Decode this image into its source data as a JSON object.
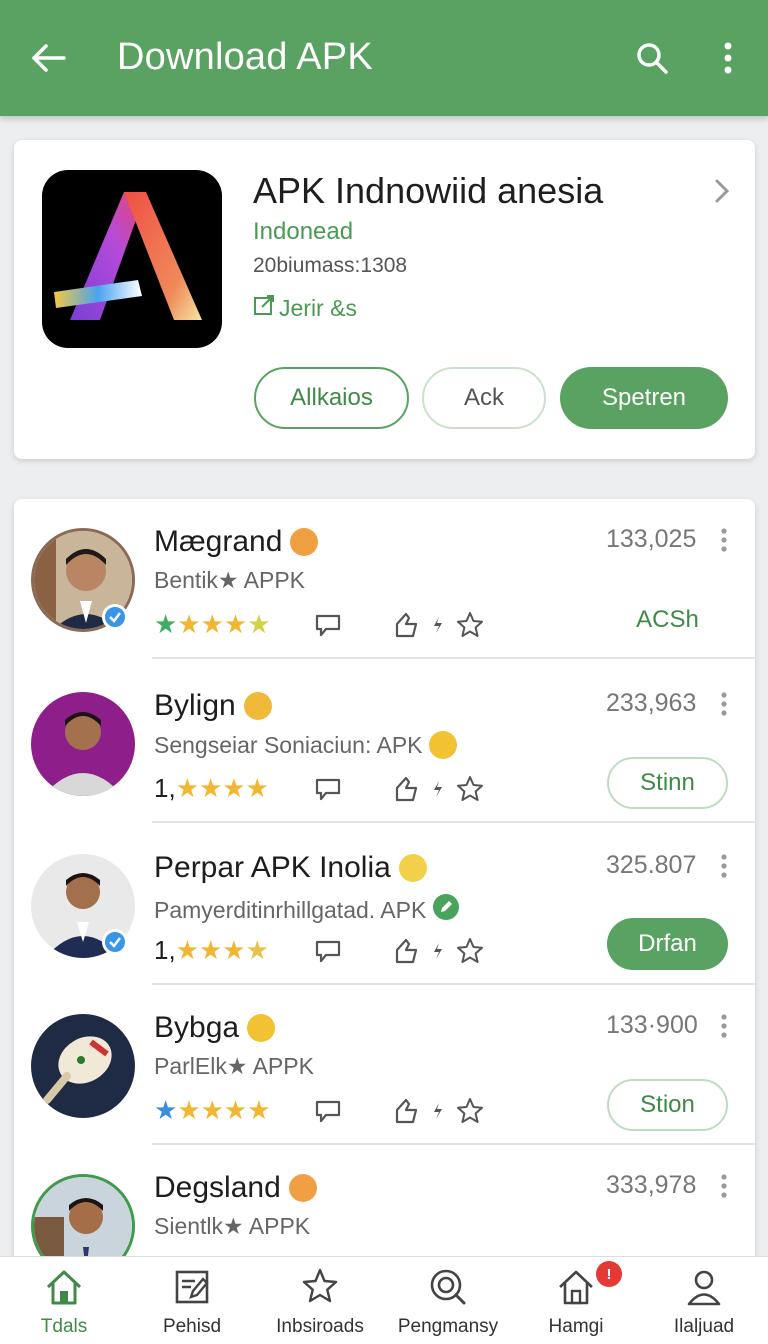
{
  "appbar": {
    "title": "Download APK",
    "back_icon": "arrow-left-icon",
    "search_icon": "search-icon",
    "more_icon": "more-vert-icon",
    "color": "#5aa262"
  },
  "featured": {
    "name": "APK Indnowiid anesia",
    "developer": "Indonead",
    "meta": "20biumass:1308",
    "link_label": "Jerir &s",
    "buttons": {
      "first": "Allkaios",
      "second": "Ack",
      "primary": "Spetren"
    }
  },
  "list": [
    {
      "name": "Mægrand",
      "subtitle": "Bentik★ APPK",
      "count": "133,025",
      "rating_prefix": "",
      "button": "ACSh",
      "button_style": "text"
    },
    {
      "name": "Bylign",
      "subtitle": "Sengseiar Soniaciun: APK",
      "count": "233,963",
      "rating_prefix": "1,",
      "button": "Stinn",
      "button_style": "outline"
    },
    {
      "name": "Perpar APK Inolia",
      "subtitle": "Pamyerditinrhillgatad. APK",
      "count": "325.807",
      "rating_prefix": "1,",
      "button": "Drfan",
      "button_style": "filled"
    },
    {
      "name": "Bybga",
      "subtitle": "ParlElk★ APPK",
      "count": "133·900",
      "rating_prefix": "",
      "button": "Stion",
      "button_style": "outline"
    },
    {
      "name": "Degsland",
      "subtitle": "Sientlk★ APPK",
      "count": "333,978",
      "rating_prefix": "",
      "button": "",
      "button_style": "none"
    }
  ],
  "bottom_nav": [
    {
      "label": "Tdals",
      "icon": "home-icon",
      "active": true
    },
    {
      "label": "Pehisd",
      "icon": "edit-note-icon",
      "active": false
    },
    {
      "label": "Inbsiroads",
      "icon": "star-icon",
      "active": false
    },
    {
      "label": "Pengmansy",
      "icon": "search-target-icon",
      "active": false
    },
    {
      "label": "Hamgi",
      "icon": "home-badge-icon",
      "active": false,
      "badge": "!"
    },
    {
      "label": "Ilaljuad",
      "icon": "profile-icon",
      "active": false
    }
  ]
}
